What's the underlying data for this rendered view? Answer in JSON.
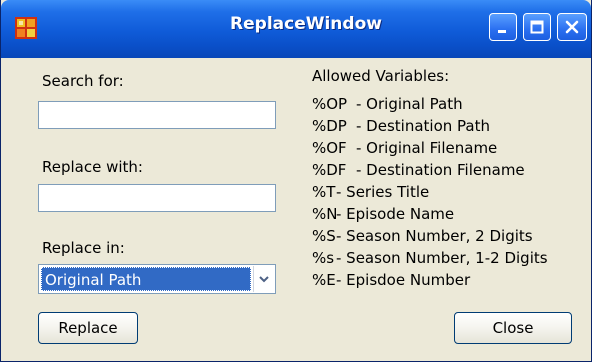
{
  "window": {
    "title": "ReplaceWindow",
    "icons": {
      "app": "app-icon",
      "minimize": "minimize-icon",
      "maximize": "maximize-icon",
      "close": "close-icon"
    }
  },
  "form": {
    "search_label": "Search for:",
    "search_value": "",
    "replace_label": "Replace with:",
    "replace_value": "",
    "replace_in_label": "Replace in:",
    "replace_in_selected": "Original Path"
  },
  "buttons": {
    "replace": "Replace",
    "close": "Close"
  },
  "variables": {
    "title": "Allowed Variables:",
    "items": [
      {
        "code": "%OP",
        "desc": "- Original Path"
      },
      {
        "code": "%DP",
        "desc": "- Destination Path"
      },
      {
        "code": "%OF",
        "desc": "- Original Filename"
      },
      {
        "code": "%DF",
        "desc": "- Destination Filename"
      },
      {
        "code": "%T",
        "desc": "- Series Title"
      },
      {
        "code": "%N",
        "desc": "- Episode Name"
      },
      {
        "code": "%S",
        "desc": "- Season Number, 2 Digits"
      },
      {
        "code": "%s",
        "desc": "- Season Number, 1-2 Digits"
      },
      {
        "code": "%E",
        "desc": "- Episdoe Number"
      }
    ]
  },
  "colors": {
    "titlebar": "#0a4fc8",
    "selection": "#316ac5",
    "dialog_bg": "#ece9d8"
  }
}
